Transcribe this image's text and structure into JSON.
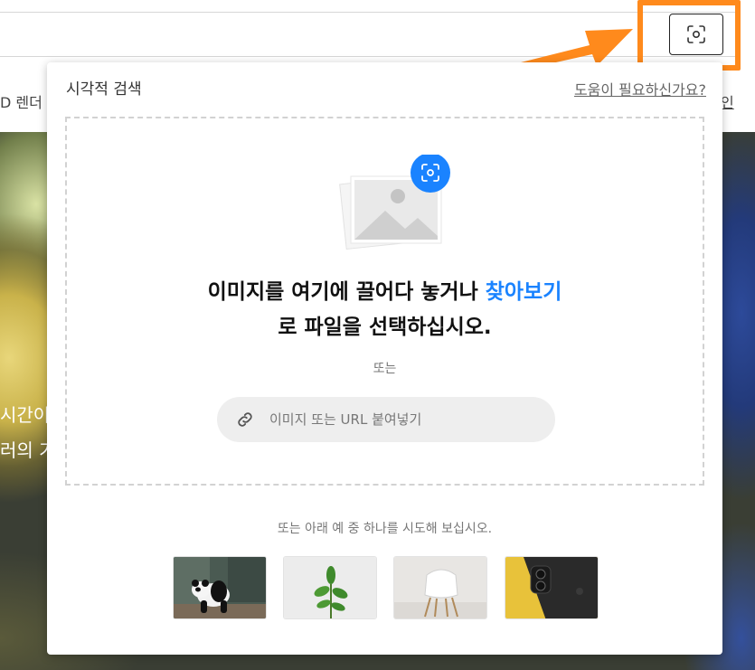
{
  "background": {
    "subnav_left": "D 렌더",
    "subnav_right": "인",
    "hero_line1": "시간이",
    "hero_line2": "러의 기"
  },
  "modal": {
    "title": "시각적 검색",
    "help_link": "도움이 필요하신가요?",
    "drop_text_before": "이미지를 여기에 끌어다 놓거나 ",
    "browse_label": "찾아보기",
    "drop_text_line2": "로 파일을 선택하십시오.",
    "or_label": "또는",
    "url_placeholder": "이미지 또는 URL 붙여넣기",
    "examples_label": "또는 아래 예 중 하나를 시도해 보십시오.",
    "examples": [
      {
        "icon": "panda-photo"
      },
      {
        "icon": "plant-photo"
      },
      {
        "icon": "chair-photo"
      },
      {
        "icon": "phone-photo"
      }
    ]
  },
  "colors": {
    "accent_blue": "#1a83ff",
    "highlight_orange": "#ff8a1c"
  }
}
